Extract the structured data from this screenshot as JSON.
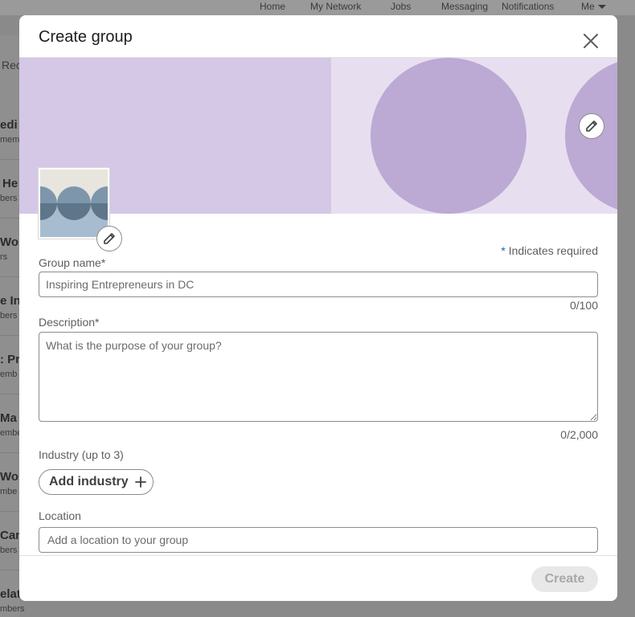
{
  "background": {
    "nav": [
      "Home",
      "My Network",
      "Jobs",
      "Messaging",
      "Notifications",
      "Me"
    ],
    "recent_fragment": "Rec",
    "rows": [
      {
        "title": "edi",
        "sub": "mem"
      },
      {
        "title": "He",
        "sub": "bers"
      },
      {
        "title": "Wor",
        "sub": "rs"
      },
      {
        "title": "e In",
        "sub": "bers"
      },
      {
        "title": ": Pr",
        "sub": "emb"
      },
      {
        "title": "Ma",
        "sub": "embe"
      },
      {
        "title": "Wor",
        "sub": "mbe"
      },
      {
        "title": "Can",
        "sub": "bers"
      },
      {
        "title": "elat",
        "sub": "mbers"
      }
    ]
  },
  "modal": {
    "title": "Create group",
    "required_star": "*",
    "required_note": "Indicates required",
    "group_name": {
      "label": "Group name*",
      "placeholder": "Inspiring Entrepreneurs in DC",
      "counter": "0/100"
    },
    "description": {
      "label": "Description*",
      "placeholder": "What is the purpose of your group?",
      "counter": "0/2,000"
    },
    "industry": {
      "label": "Industry (up to 3)",
      "button_label": "Add industry"
    },
    "location": {
      "label": "Location",
      "placeholder": "Add a location to your group"
    },
    "create_label": "Create"
  },
  "colors": {
    "accent": "#0a66c2",
    "cover_light": "#e7dff0",
    "cover_mid": "#d4c8e6",
    "cover_circle": "#bca9d4"
  }
}
